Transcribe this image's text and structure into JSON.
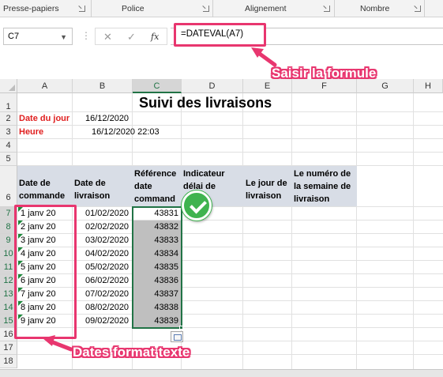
{
  "ribbon": {
    "groups": [
      {
        "label": "Presse-papiers"
      },
      {
        "label": "Police"
      },
      {
        "label": "Alignement"
      },
      {
        "label": "Nombre"
      }
    ]
  },
  "formula_bar": {
    "name_box": "C7",
    "fx_label": "fx",
    "formula": "=DATEVAL(A7)"
  },
  "annotations": {
    "formula_callout": "Saisir la formule",
    "dates_callout": "Dates format texte"
  },
  "columns": [
    "A",
    "B",
    "C",
    "D",
    "E",
    "F",
    "G",
    "H"
  ],
  "selected_column": "C",
  "rows": [
    "1",
    "2",
    "3",
    "4",
    "5",
    "6",
    "7",
    "8",
    "9",
    "10",
    "11",
    "12",
    "13",
    "14",
    "15",
    "16",
    "17",
    "18"
  ],
  "sheet": {
    "title": "Suivi des livraisons",
    "date_label": "Date du jour",
    "date_value": "16/12/2020",
    "hour_label": "Heure",
    "hour_value": "16/12/2020 22:03",
    "headers": {
      "a": "Date de commande",
      "b": "Date de livraison",
      "c": "Référence date command",
      "d": "Indicateur délai de",
      "e": "Le jour de livraison",
      "f": "Le numéro de la semaine de livraison"
    },
    "data_rows": [
      {
        "a": "1 janv 20",
        "b": "01/02/2020",
        "c": "43831"
      },
      {
        "a": "2 janv 20",
        "b": "02/02/2020",
        "c": "43832"
      },
      {
        "a": "3 janv 20",
        "b": "03/02/2020",
        "c": "43833"
      },
      {
        "a": "4 janv 20",
        "b": "04/02/2020",
        "c": "43834"
      },
      {
        "a": "5 janv 20",
        "b": "05/02/2020",
        "c": "43835"
      },
      {
        "a": "6 janv 20",
        "b": "06/02/2020",
        "c": "43836"
      },
      {
        "a": "7 janv 20",
        "b": "07/02/2020",
        "c": "43837"
      },
      {
        "a": "8 janv 20",
        "b": "08/02/2020",
        "c": "43838"
      },
      {
        "a": "9 janv 20",
        "b": "09/02/2020",
        "c": "43839"
      }
    ]
  },
  "colors": {
    "accent": "#217346",
    "highlight": "#e8366f",
    "label_red": "#e02020",
    "header_fill": "#d8dde6"
  }
}
